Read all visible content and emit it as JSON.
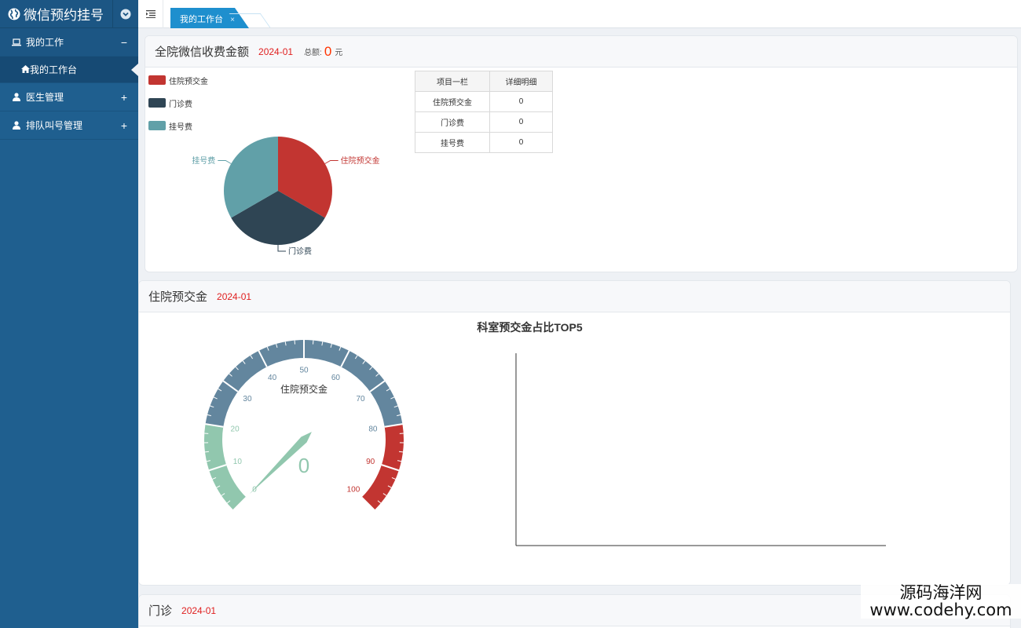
{
  "app": {
    "title": "微信预约挂号"
  },
  "sidebar": {
    "items": [
      {
        "label": "我的工作",
        "sign": "−"
      },
      {
        "label": "我的工作台"
      },
      {
        "label": "医生管理",
        "sign": "+"
      },
      {
        "label": "排队叫号管理",
        "sign": "+"
      }
    ]
  },
  "tabs": [
    {
      "label": "我的工作台",
      "close": "×"
    }
  ],
  "panel1": {
    "title": "全院微信收费金额",
    "date": "2024-01",
    "total_label": "总额:",
    "total_value": "0",
    "unit": "元",
    "table": {
      "headers": [
        "项目一栏",
        "详细明细"
      ],
      "rows": [
        [
          "住院预交金",
          "0"
        ],
        [
          "门诊费",
          "0"
        ],
        [
          "挂号费",
          "0"
        ]
      ]
    }
  },
  "panel2": {
    "title": "住院预交金",
    "date": "2024-01"
  },
  "panel3": {
    "title": "门诊",
    "date": "2024-01"
  },
  "watermark": {
    "line1": "源码海洋网",
    "line2": "www.codehy.com"
  },
  "colors": {
    "sidebar": "#1f5f8f",
    "accent": "#1e8fce",
    "red": "#c23531",
    "dark": "#2f4554",
    "teal": "#61a0a8",
    "gauge_green": "#91c7ae",
    "gauge_blue": "#63869e"
  },
  "chart_data": [
    {
      "type": "pie",
      "categories": [
        "住院预交金",
        "门诊费",
        "挂号费"
      ],
      "values": [
        0,
        0,
        0
      ],
      "colors": [
        "#c23531",
        "#2f4554",
        "#61a0a8"
      ],
      "legend": "top-left"
    },
    {
      "type": "gauge",
      "name": "住院预交金",
      "value": 0,
      "min": 0,
      "max": 100,
      "ticks": [
        "0",
        "10",
        "20",
        "30",
        "40",
        "50",
        "60",
        "70",
        "80",
        "90",
        "100"
      ],
      "value_label": "0"
    },
    {
      "type": "bar",
      "title": "科室预交金占比TOP5",
      "categories": [],
      "values": []
    }
  ]
}
